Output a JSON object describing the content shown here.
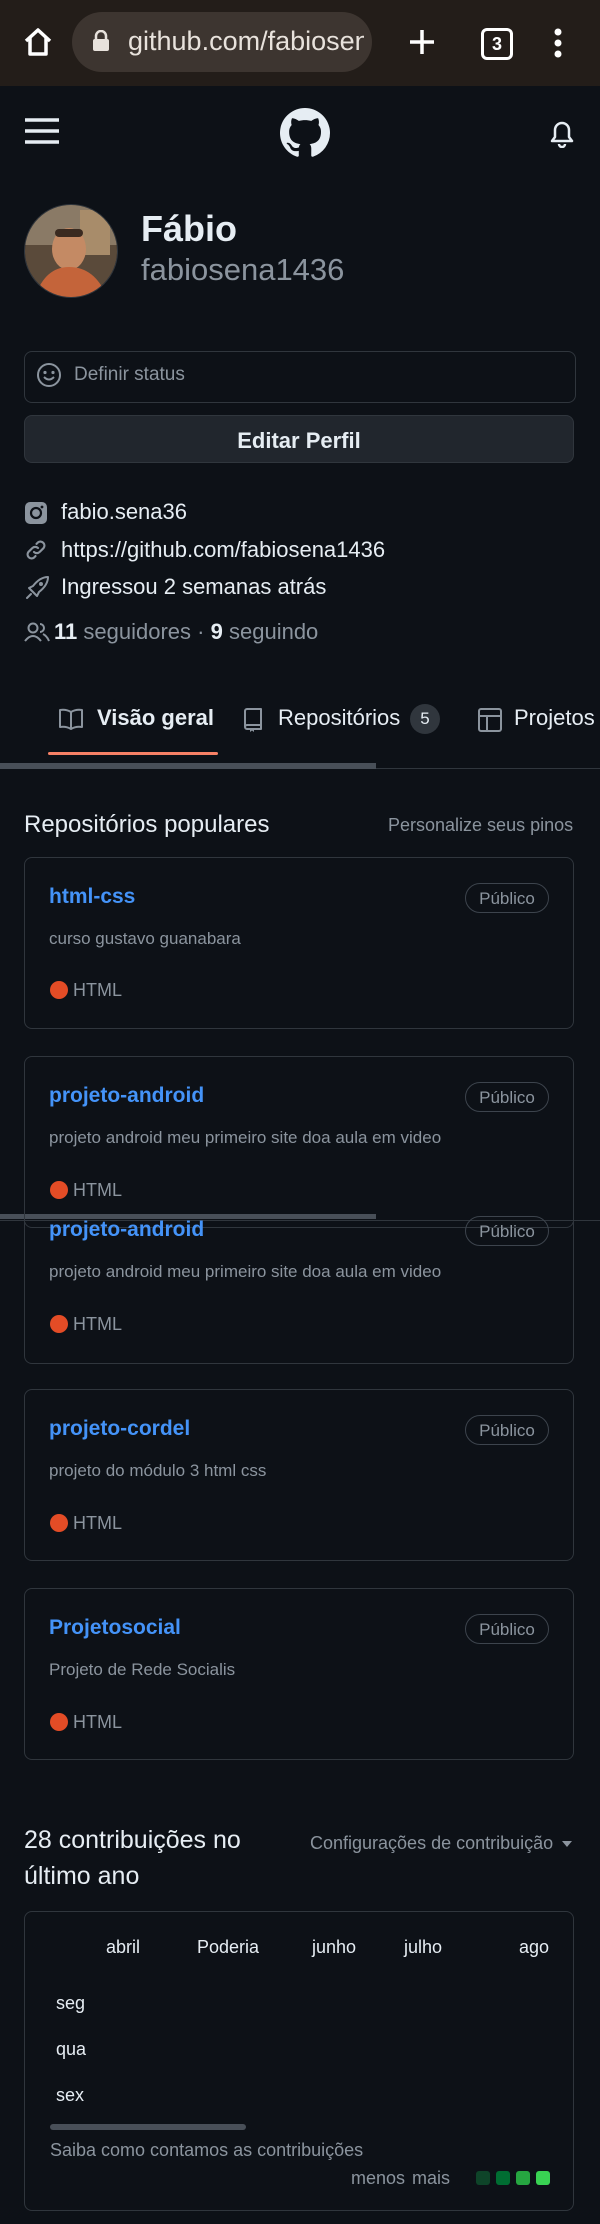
{
  "browser": {
    "url": "github.com/fabiosena1436",
    "tab_count": "3"
  },
  "profile": {
    "name": "Fábio",
    "login": "fabiosena1436",
    "status_placeholder": "Definir status",
    "edit_button": "Editar Perfil",
    "instagram": "fabio.sena36",
    "website": "https://github.com/fabiosena1436",
    "joined": "Ingressou 2 semanas atrás",
    "followers_count": "11",
    "followers_label": "seguidores",
    "separator": "·",
    "following_count": "9",
    "following_label": "seguindo"
  },
  "tabs": [
    {
      "label": "Visão geral",
      "active": true
    },
    {
      "label": "Repositórios",
      "count": "5"
    },
    {
      "label": "Projetos"
    }
  ],
  "popular": {
    "title": "Repositórios populares",
    "customize": "Personalize seus pinos",
    "repos": [
      {
        "name": "html-css",
        "visibility": "Público",
        "description": "curso gustavo guanabara",
        "language": "HTML"
      },
      {
        "name": "projeto-android",
        "visibility": "Público",
        "description": "projeto android meu primeiro site doa aula em video",
        "language": "HTML"
      },
      {
        "name": "projeto-android",
        "visibility": "Público",
        "description": "projeto android meu primeiro site doa aula em video",
        "language": "HTML"
      },
      {
        "name": "projeto-cordel",
        "visibility": "Público",
        "description": "projeto do módulo 3 html css",
        "language": "HTML"
      },
      {
        "name": "Projetosocial",
        "visibility": "Público",
        "description": "Projeto de Rede Socialis",
        "language": "HTML"
      }
    ]
  },
  "contributions": {
    "title": "28 contribuições no último ano",
    "settings": "Configurações de contribuição",
    "months": [
      "abril",
      "Poderia",
      "junho",
      "julho",
      "ago"
    ],
    "days": [
      "seg",
      "qua",
      "sex"
    ],
    "help": "Saiba como contamos as contribuições",
    "legend_less": "menos",
    "legend_more": "mais",
    "legend_colors": [
      "#0e4429",
      "#006d32",
      "#26a641",
      "#39d353"
    ]
  },
  "colors": {
    "accent": "#f78166",
    "link": "#4493f8",
    "html_lang": "#e34c26"
  }
}
